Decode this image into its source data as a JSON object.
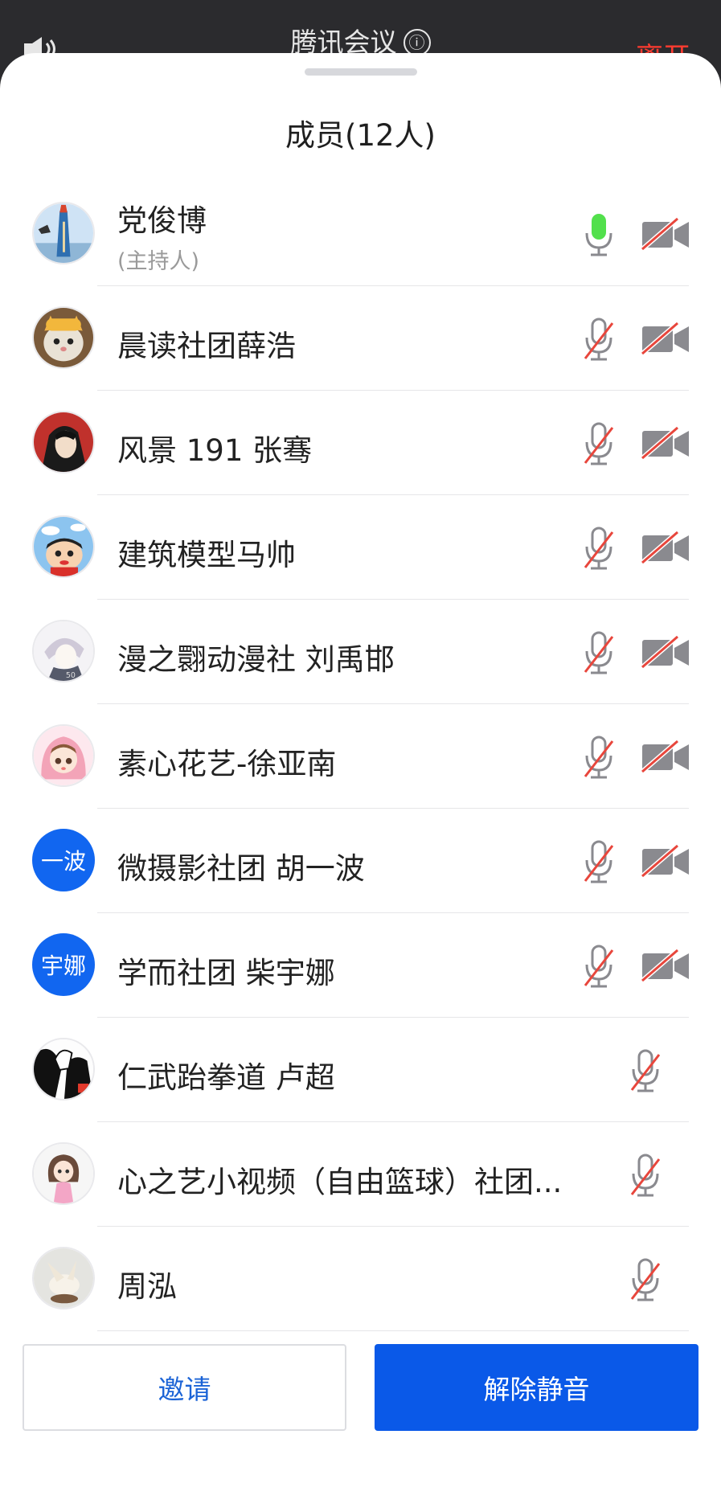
{
  "app": {
    "title": "腾讯会议",
    "info_icon": "ⓘ",
    "leave_label": "离开"
  },
  "panel": {
    "title": "成员(12人)"
  },
  "members": [
    {
      "name": "党俊博",
      "role": "(主持人)",
      "mic": "on",
      "cam": "off",
      "avatar": "tower"
    },
    {
      "name": "晨读社团薛浩",
      "mic": "muted",
      "cam": "off",
      "avatar": "cat"
    },
    {
      "name": "风景 191 张骞",
      "mic": "muted",
      "cam": "off",
      "avatar": "red-anime"
    },
    {
      "name": "建筑模型马帅",
      "mic": "muted",
      "cam": "off",
      "avatar": "cartoon-boy"
    },
    {
      "name": "漫之翾动漫社 刘禹邯",
      "mic": "muted",
      "cam": "off",
      "avatar": "sketch"
    },
    {
      "name": "素心花艺-徐亚南",
      "mic": "muted",
      "cam": "off",
      "avatar": "pink-girl"
    },
    {
      "name": "微摄影社团 胡一波",
      "mic": "muted",
      "cam": "off",
      "avatar_text": "一波"
    },
    {
      "name": "学而社团 柴宇娜",
      "mic": "muted",
      "cam": "off",
      "avatar_text": "宇娜"
    },
    {
      "name": "仁武跆拳道 卢超",
      "mic": "muted",
      "avatar": "bw-hands"
    },
    {
      "name": "心之艺小视频（自由篮球）社团...",
      "mic": "muted",
      "avatar": "doll-girl"
    },
    {
      "name": "周泓",
      "mic": "muted",
      "avatar": "bird"
    }
  ],
  "actions": {
    "invite_label": "邀请",
    "unmute_all_label": "解除静音"
  },
  "colors": {
    "accent": "#0a59e8",
    "mic_active": "#52e04c",
    "mute_slash": "#e8463c",
    "leave": "#ff3b30"
  }
}
